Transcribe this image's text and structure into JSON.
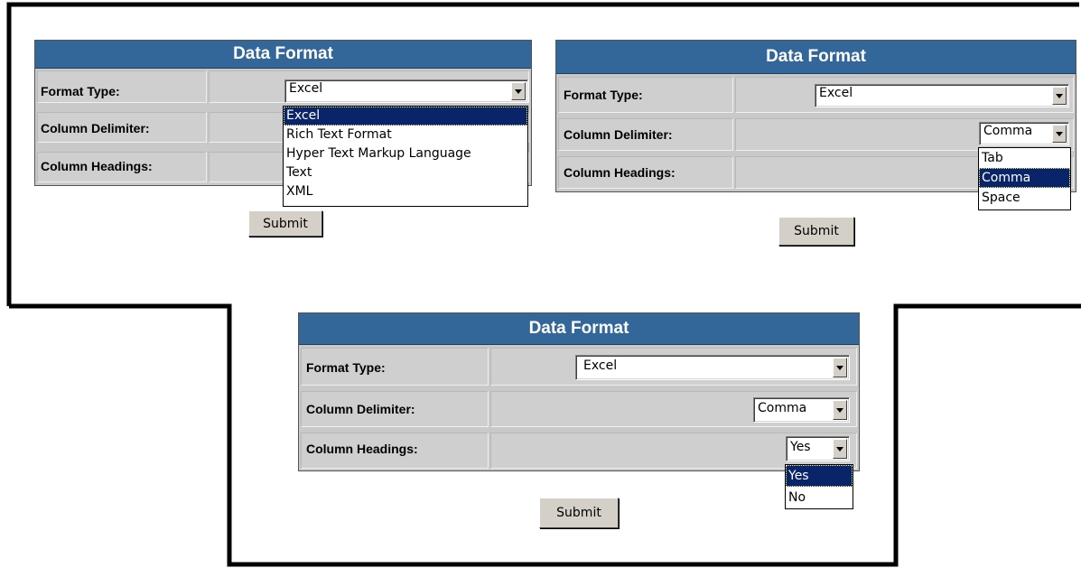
{
  "panels": [
    {
      "title": "Data Format",
      "rows": [
        {
          "label": "Format Type:",
          "value": "Excel"
        },
        {
          "label": "Column Delimiter:",
          "value": ""
        },
        {
          "label": "Column Headings:",
          "value": ""
        }
      ],
      "dropdown": {
        "options": [
          "Excel",
          "Rich Text Format",
          "Hyper Text Markup Language",
          "Text",
          "XML"
        ],
        "highlighted": "Excel"
      },
      "submit_label": "Submit"
    },
    {
      "title": "Data Format",
      "rows": [
        {
          "label": "Format Type:",
          "value": "Excel"
        },
        {
          "label": "Column Delimiter:",
          "value": "Comma"
        },
        {
          "label": "Column Headings:",
          "value": ""
        }
      ],
      "dropdown": {
        "options": [
          "Tab",
          "Comma",
          "Space"
        ],
        "highlighted": "Comma"
      },
      "submit_label": "Submit"
    },
    {
      "title": "Data Format",
      "rows": [
        {
          "label": "Format Type:",
          "value": "Excel"
        },
        {
          "label": "Column Delimiter:",
          "value": "Comma"
        },
        {
          "label": "Column Headings:",
          "value": "Yes"
        }
      ],
      "dropdown": {
        "options": [
          "Yes",
          "No"
        ],
        "highlighted": "Yes"
      },
      "submit_label": "Submit"
    }
  ]
}
